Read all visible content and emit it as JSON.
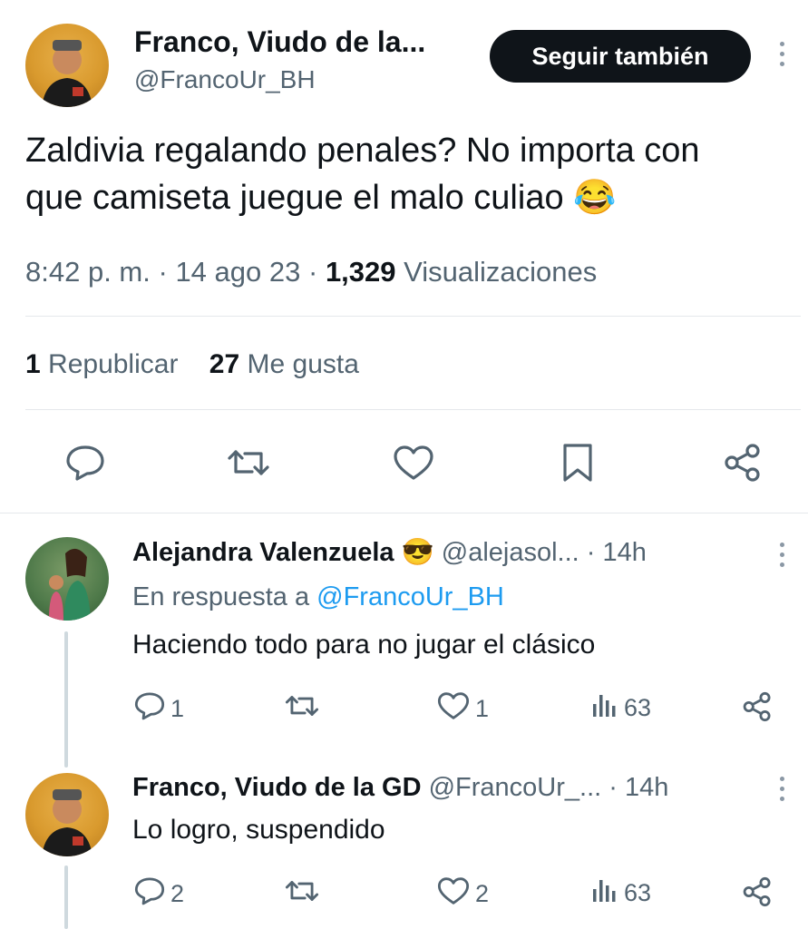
{
  "main_tweet": {
    "author_name": "Franco, Viudo de la...",
    "author_handle": "@FrancoUr_BH",
    "follow_label": "Seguir también",
    "text_line1": "Zaldivia regalando penales? No importa con",
    "text_line2": "que camiseta juegue el malo culiao",
    "emoji": "😂",
    "time": "8:42 p. m.",
    "sep1": "·",
    "date": "14 ago 23",
    "sep2": "·",
    "views_count": "1,329",
    "views_label": "Visualizaciones",
    "reposts_count": "1",
    "reposts_label": "Republicar",
    "likes_count": "27",
    "likes_label": "Me gusta"
  },
  "replies": [
    {
      "author_name": "Alejandra Valenzuela",
      "emoji": "😎",
      "author_handle": "@alejasol...",
      "time": "· 14h",
      "reply_prefix": "En respuesta a",
      "reply_to": "@FrancoUr_BH",
      "text": "Haciendo todo para no jugar el clásico",
      "replies_count": "1",
      "retweets_count": "",
      "likes_count": "1",
      "views_count": "63"
    },
    {
      "author_name": "Franco, Viudo de la GD",
      "author_handle": "@FrancoUr_...",
      "time": "· 14h",
      "text": "Lo logro, suspendido",
      "replies_count": "2",
      "retweets_count": "",
      "likes_count": "2",
      "views_count": "63"
    }
  ],
  "colors": {
    "text": "#0f1419",
    "muted": "#536471",
    "link": "#1d9bf0",
    "button_bg": "#0f1419"
  },
  "icons": [
    "reply-icon",
    "retweet-icon",
    "like-icon",
    "bookmark-icon",
    "share-icon",
    "views-icon",
    "more-icon"
  ]
}
